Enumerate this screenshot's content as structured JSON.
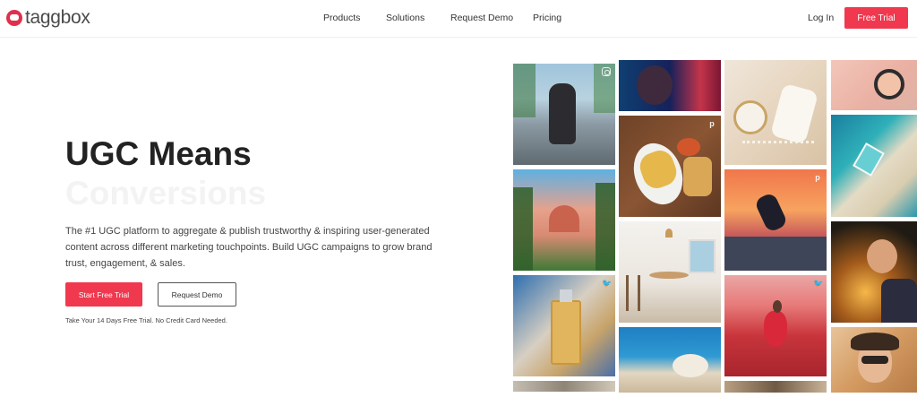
{
  "brand": {
    "name": "taggbox",
    "accent": "#f0384e"
  },
  "nav": {
    "items": [
      "Products",
      "Solutions",
      "Request Demo",
      "Pricing"
    ],
    "login": "Log In",
    "cta": "Free Trial"
  },
  "hero": {
    "title": "UGC Means",
    "title_faded": "Conversions",
    "description": "The #1 UGC platform to aggregate & publish trustworthy & inspiring user-generated content across different marketing touchpoints. Build UGC campaigns to grow brand trust, engagement, & sales.",
    "primary_button": "Start Free Trial",
    "secondary_button": "Request Demo",
    "note": "Take Your 14 Days Free Trial. No Credit Card Needed."
  },
  "gallery": {
    "photos": [
      {
        "name": "skater-street-photo",
        "badge": "instagram"
      },
      {
        "name": "pink-building-palms-photo",
        "badge": ""
      },
      {
        "name": "perfume-bottle-photo",
        "badge": "twitter"
      },
      {
        "name": "partial-photo-col1",
        "badge": ""
      },
      {
        "name": "neon-portrait-photo",
        "badge": ""
      },
      {
        "name": "fries-food-photo",
        "badge": "pinterest"
      },
      {
        "name": "dining-room-interior-photo",
        "badge": ""
      },
      {
        "name": "pool-breakfast-photo",
        "badge": ""
      },
      {
        "name": "pearls-accessories-photo",
        "badge": ""
      },
      {
        "name": "sunset-skateboarder-photo",
        "badge": "pinterest"
      },
      {
        "name": "tulip-field-dancer-photo",
        "badge": "twitter"
      },
      {
        "name": "partial-photo-col3",
        "badge": ""
      },
      {
        "name": "compact-powder-photo",
        "badge": ""
      },
      {
        "name": "aerial-beach-photo",
        "badge": ""
      },
      {
        "name": "child-fairy-lights-photo",
        "badge": ""
      },
      {
        "name": "woman-sunglasses-photo",
        "badge": ""
      }
    ]
  }
}
